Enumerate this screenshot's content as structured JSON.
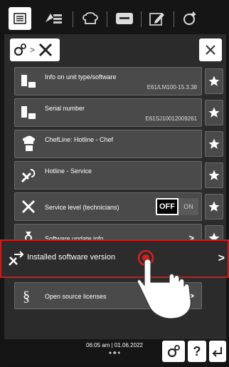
{
  "toolbar": {
    "items": [
      "menu",
      "cookbook",
      "chef-hat",
      "program",
      "edit",
      "settings"
    ]
  },
  "breadcrumb": {
    "separator": ">"
  },
  "rows": [
    {
      "label": "Info on unit type/software",
      "value": "E61/LM100-15.3.38",
      "icon": "unit-info-icon"
    },
    {
      "label": "Serial number",
      "value": "E61SJ10012009261",
      "icon": "serial-number-icon"
    },
    {
      "label": "ChefLine: Hotline - Chef",
      "value": "",
      "icon": "chef-hotline-icon"
    },
    {
      "label": "Hotline - Service",
      "value": "",
      "icon": "service-hotline-icon"
    },
    {
      "label": "Service level (technicians)",
      "value": "",
      "icon": "wrench-icon",
      "toggle": {
        "off": "OFF",
        "on": "ON",
        "state": "OFF"
      }
    },
    {
      "label": "Software update info",
      "value": "",
      "icon": "software-update-icon",
      "chevron": ">"
    },
    {
      "label": "Installed software version",
      "value": "",
      "icon": "installed-software-icon",
      "chevron": ">"
    },
    {
      "label": "Open source licenses",
      "value": "",
      "icon": "licenses-icon",
      "chevron": ">"
    }
  ],
  "status": {
    "time": "06:05 am",
    "separator": "|",
    "date": "01.06.2022"
  },
  "bottom": {
    "help_label": "?"
  },
  "colors": {
    "highlight_border": "#d01a1a",
    "row_bg": "#4a4a4a"
  }
}
